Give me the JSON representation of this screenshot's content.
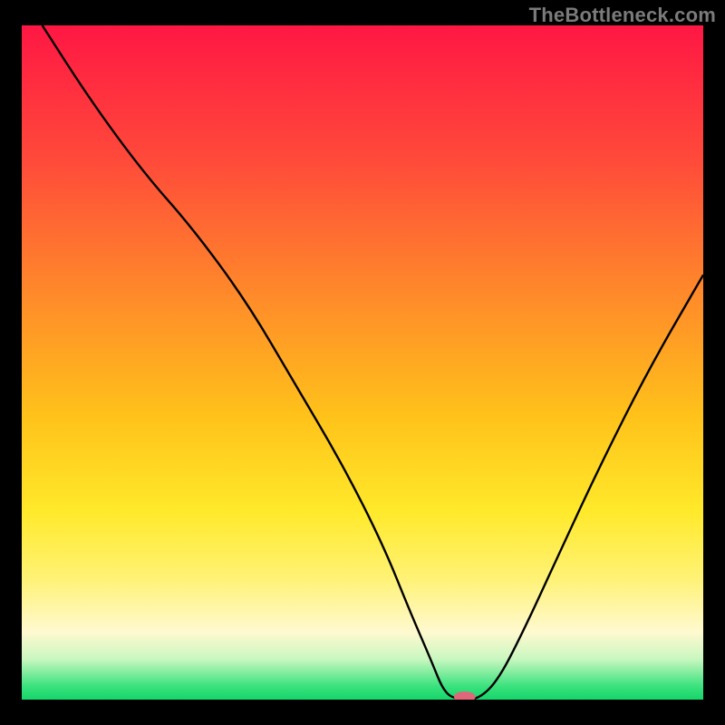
{
  "watermark": "TheBottleneck.com",
  "chart_data": {
    "type": "line",
    "title": "",
    "xlabel": "",
    "ylabel": "",
    "xlim": [
      0,
      100
    ],
    "ylim": [
      0,
      100
    ],
    "grid": false,
    "legend": false,
    "gradient_stops": [
      {
        "offset": 0,
        "color": "#ff1744"
      },
      {
        "offset": 20,
        "color": "#ff4a3a"
      },
      {
        "offset": 40,
        "color": "#ff8a2a"
      },
      {
        "offset": 58,
        "color": "#ffc21a"
      },
      {
        "offset": 72,
        "color": "#ffe92a"
      },
      {
        "offset": 82,
        "color": "#fff275"
      },
      {
        "offset": 90,
        "color": "#fff9d0"
      },
      {
        "offset": 94,
        "color": "#c9f7c0"
      },
      {
        "offset": 98,
        "color": "#3be27e"
      },
      {
        "offset": 100,
        "color": "#15d56a"
      }
    ],
    "series": [
      {
        "name": "bottleneck-curve",
        "x": [
          3,
          10,
          18,
          25,
          33,
          40,
          47,
          53,
          57,
          60,
          62,
          64,
          67,
          70,
          74,
          79,
          85,
          92,
          100
        ],
        "y": [
          100,
          89,
          78,
          70,
          59,
          47,
          35,
          23,
          13,
          6,
          1,
          0,
          0,
          3,
          11,
          22,
          35,
          49,
          63
        ]
      }
    ],
    "marker": {
      "name": "bottleneck-point",
      "x": 65,
      "y": 0,
      "color": "#e0677a",
      "rx": 12,
      "ry": 6
    }
  }
}
